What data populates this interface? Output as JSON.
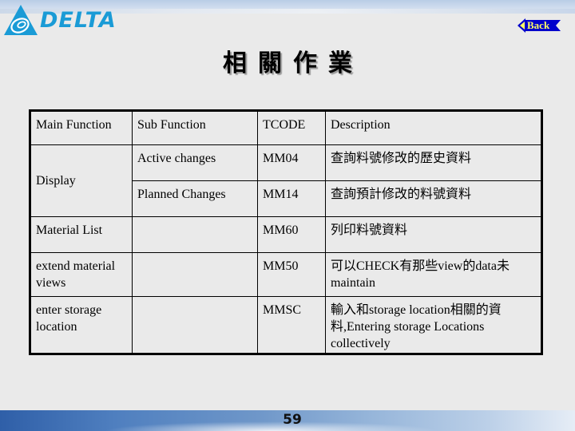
{
  "header": {
    "logo_text": "DELTA",
    "back_label": "Back",
    "title": "相關作業"
  },
  "colors": {
    "logo_blue": "#1a9bd6",
    "back_button_blue": "#0000cc",
    "back_text_yellow": "#ffff66",
    "background": "#eaeaea"
  },
  "table": {
    "headers": [
      "Main Function",
      "Sub Function",
      "TCODE",
      "Description"
    ],
    "rows": [
      {
        "main": "Display",
        "sub": "Active changes",
        "tcode": "MM04",
        "desc": "查詢料號修改的歷史資料"
      },
      {
        "main": "",
        "sub": "Planned Changes",
        "tcode": "MM14",
        "desc": "查詢預計修改的料號資料"
      },
      {
        "main": "Material List",
        "sub": "",
        "tcode": "MM60",
        "desc": "列印料號資料"
      },
      {
        "main": "extend material views",
        "sub": "",
        "tcode": "MM50",
        "desc": "可以CHECK有那些view的data未maintain"
      },
      {
        "main": "enter storage location",
        "sub": "",
        "tcode": "MMSC",
        "desc": "輸入和storage location相關的資料,Entering  storage Locations collectively"
      }
    ]
  },
  "footer": {
    "page_number": "59"
  }
}
